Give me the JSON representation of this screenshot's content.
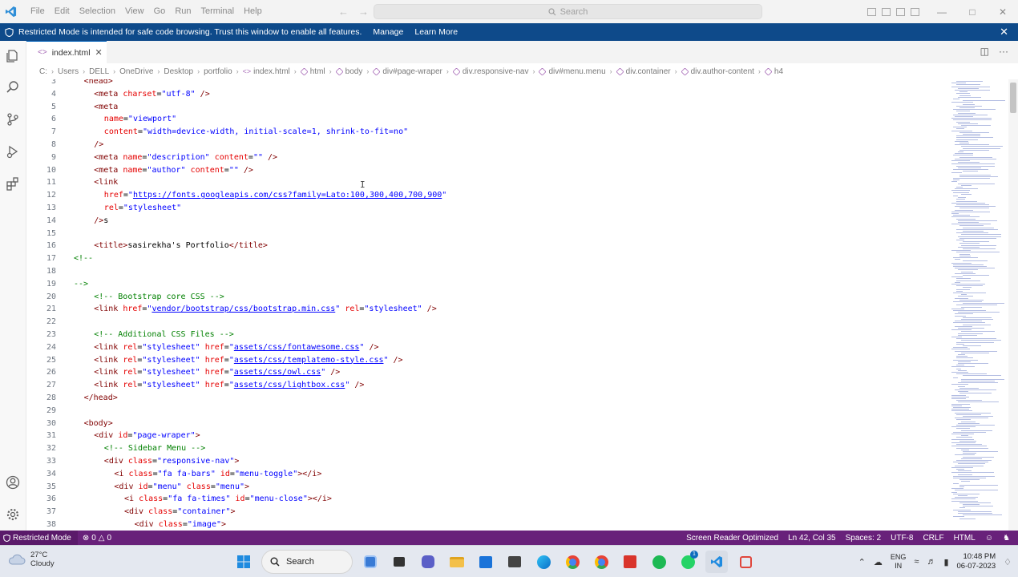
{
  "titlebar": {
    "menu": [
      "File",
      "Edit",
      "Selection",
      "View",
      "Go",
      "Run",
      "Terminal",
      "Help"
    ],
    "search_placeholder": "Search"
  },
  "banner": {
    "message": "Restricted Mode is intended for safe code browsing. Trust this window to enable all features.",
    "manage_label": "Manage",
    "learn_more_label": "Learn More"
  },
  "tab": {
    "label": "index.html"
  },
  "breadcrumb": [
    "C:",
    "Users",
    "DELL",
    "OneDrive",
    "Desktop",
    "portfolio",
    "index.html",
    "html",
    "body",
    "div#page-wraper",
    "div.responsive-nav",
    "div#menu.menu",
    "div.container",
    "div.author-content",
    "h4"
  ],
  "editor": {
    "lines": [
      {
        "n": "3",
        "indent": 1,
        "segs": [
          [
            "tag",
            "<head>"
          ]
        ]
      },
      {
        "n": "4",
        "indent": 2,
        "segs": [
          [
            "tag",
            "<meta "
          ],
          [
            "attr",
            "charset"
          ],
          [
            "txt",
            "="
          ],
          [
            "val",
            "\"utf-8\""
          ],
          [
            "tag",
            " />"
          ]
        ]
      },
      {
        "n": "5",
        "indent": 2,
        "segs": [
          [
            "tag",
            "<meta"
          ]
        ]
      },
      {
        "n": "6",
        "indent": 3,
        "segs": [
          [
            "attr",
            "name"
          ],
          [
            "txt",
            "="
          ],
          [
            "val",
            "\"viewport\""
          ]
        ]
      },
      {
        "n": "7",
        "indent": 3,
        "segs": [
          [
            "attr",
            "content"
          ],
          [
            "txt",
            "="
          ],
          [
            "val",
            "\"width=device-width, initial-scale=1, shrink-to-fit=no\""
          ]
        ]
      },
      {
        "n": "8",
        "indent": 2,
        "segs": [
          [
            "tag",
            "/>"
          ]
        ]
      },
      {
        "n": "9",
        "indent": 2,
        "segs": [
          [
            "tag",
            "<meta "
          ],
          [
            "attr",
            "name"
          ],
          [
            "txt",
            "="
          ],
          [
            "val",
            "\"description\""
          ],
          [
            "txt",
            " "
          ],
          [
            "attr",
            "content"
          ],
          [
            "txt",
            "="
          ],
          [
            "val",
            "\"\""
          ],
          [
            "tag",
            " />"
          ]
        ]
      },
      {
        "n": "10",
        "indent": 2,
        "segs": [
          [
            "tag",
            "<meta "
          ],
          [
            "attr",
            "name"
          ],
          [
            "txt",
            "="
          ],
          [
            "val",
            "\"author\""
          ],
          [
            "txt",
            " "
          ],
          [
            "attr",
            "content"
          ],
          [
            "txt",
            "="
          ],
          [
            "val",
            "\"\""
          ],
          [
            "tag",
            " />"
          ]
        ]
      },
      {
        "n": "11",
        "indent": 2,
        "segs": [
          [
            "tag",
            "<link"
          ]
        ]
      },
      {
        "n": "12",
        "indent": 3,
        "segs": [
          [
            "attr",
            "href"
          ],
          [
            "txt",
            "="
          ],
          [
            "val",
            "\""
          ],
          [
            "lnk",
            "https://fonts.googleapis.com/css?family=Lato:100,300,400,700,900"
          ],
          [
            "val",
            "\""
          ]
        ]
      },
      {
        "n": "13",
        "indent": 3,
        "segs": [
          [
            "attr",
            "rel"
          ],
          [
            "txt",
            "="
          ],
          [
            "val",
            "\"stylesheet\""
          ]
        ]
      },
      {
        "n": "14",
        "indent": 2,
        "segs": [
          [
            "tag",
            "/>"
          ],
          [
            "txt",
            "s"
          ]
        ]
      },
      {
        "n": "15",
        "indent": 0,
        "segs": []
      },
      {
        "n": "16",
        "indent": 2,
        "segs": [
          [
            "tag",
            "<title>"
          ],
          [
            "txt",
            "sasirekha's Portfolio"
          ],
          [
            "tag",
            "</title>"
          ]
        ]
      },
      {
        "n": "17",
        "indent": 0,
        "segs": [
          [
            "cmt",
            "<!--"
          ]
        ]
      },
      {
        "n": "18",
        "indent": 0,
        "segs": []
      },
      {
        "n": "19",
        "indent": 0,
        "segs": [
          [
            "cmt",
            "-->"
          ]
        ]
      },
      {
        "n": "20",
        "indent": 2,
        "segs": [
          [
            "cmt",
            "<!-- Bootstrap core CSS -->"
          ]
        ]
      },
      {
        "n": "21",
        "indent": 2,
        "segs": [
          [
            "tag",
            "<link "
          ],
          [
            "attr",
            "href"
          ],
          [
            "txt",
            "="
          ],
          [
            "val",
            "\""
          ],
          [
            "lnk",
            "vendor/bootstrap/css/bootstrap.min.css"
          ],
          [
            "val",
            "\""
          ],
          [
            "txt",
            " "
          ],
          [
            "attr",
            "rel"
          ],
          [
            "txt",
            "="
          ],
          [
            "val",
            "\"stylesheet\""
          ],
          [
            "tag",
            " />"
          ]
        ]
      },
      {
        "n": "22",
        "indent": 0,
        "segs": []
      },
      {
        "n": "23",
        "indent": 2,
        "segs": [
          [
            "cmt",
            "<!-- Additional CSS Files -->"
          ]
        ]
      },
      {
        "n": "24",
        "indent": 2,
        "segs": [
          [
            "tag",
            "<link "
          ],
          [
            "attr",
            "rel"
          ],
          [
            "txt",
            "="
          ],
          [
            "val",
            "\"stylesheet\""
          ],
          [
            "txt",
            " "
          ],
          [
            "attr",
            "href"
          ],
          [
            "txt",
            "="
          ],
          [
            "val",
            "\""
          ],
          [
            "lnk",
            "assets/css/fontawesome.css"
          ],
          [
            "val",
            "\""
          ],
          [
            "tag",
            " />"
          ]
        ]
      },
      {
        "n": "25",
        "indent": 2,
        "segs": [
          [
            "tag",
            "<link "
          ],
          [
            "attr",
            "rel"
          ],
          [
            "txt",
            "="
          ],
          [
            "val",
            "\"stylesheet\""
          ],
          [
            "txt",
            " "
          ],
          [
            "attr",
            "href"
          ],
          [
            "txt",
            "="
          ],
          [
            "val",
            "\""
          ],
          [
            "lnk",
            "assets/css/templatemo-style.css"
          ],
          [
            "val",
            "\""
          ],
          [
            "tag",
            " />"
          ]
        ]
      },
      {
        "n": "26",
        "indent": 2,
        "segs": [
          [
            "tag",
            "<link "
          ],
          [
            "attr",
            "rel"
          ],
          [
            "txt",
            "="
          ],
          [
            "val",
            "\"stylesheet\""
          ],
          [
            "txt",
            " "
          ],
          [
            "attr",
            "href"
          ],
          [
            "txt",
            "="
          ],
          [
            "val",
            "\""
          ],
          [
            "lnk",
            "assets/css/owl.css"
          ],
          [
            "val",
            "\""
          ],
          [
            "tag",
            " />"
          ]
        ]
      },
      {
        "n": "27",
        "indent": 2,
        "segs": [
          [
            "tag",
            "<link "
          ],
          [
            "attr",
            "rel"
          ],
          [
            "txt",
            "="
          ],
          [
            "val",
            "\"stylesheet\""
          ],
          [
            "txt",
            " "
          ],
          [
            "attr",
            "href"
          ],
          [
            "txt",
            "="
          ],
          [
            "val",
            "\""
          ],
          [
            "lnk",
            "assets/css/lightbox.css"
          ],
          [
            "val",
            "\""
          ],
          [
            "tag",
            " />"
          ]
        ]
      },
      {
        "n": "28",
        "indent": 1,
        "segs": [
          [
            "tag",
            "</head>"
          ]
        ]
      },
      {
        "n": "29",
        "indent": 0,
        "segs": []
      },
      {
        "n": "30",
        "indent": 1,
        "segs": [
          [
            "tag",
            "<body>"
          ]
        ]
      },
      {
        "n": "31",
        "indent": 2,
        "segs": [
          [
            "tag",
            "<div "
          ],
          [
            "attr",
            "id"
          ],
          [
            "txt",
            "="
          ],
          [
            "val",
            "\"page-wraper\""
          ],
          [
            "tag",
            ">"
          ]
        ]
      },
      {
        "n": "32",
        "indent": 3,
        "segs": [
          [
            "cmt",
            "<!-- Sidebar Menu -->"
          ]
        ]
      },
      {
        "n": "33",
        "indent": 3,
        "segs": [
          [
            "tag",
            "<div "
          ],
          [
            "attr",
            "class"
          ],
          [
            "txt",
            "="
          ],
          [
            "val",
            "\"responsive-nav\""
          ],
          [
            "tag",
            ">"
          ]
        ]
      },
      {
        "n": "34",
        "indent": 4,
        "segs": [
          [
            "tag",
            "<i "
          ],
          [
            "attr",
            "class"
          ],
          [
            "txt",
            "="
          ],
          [
            "val",
            "\"fa fa-bars\""
          ],
          [
            "txt",
            " "
          ],
          [
            "attr",
            "id"
          ],
          [
            "txt",
            "="
          ],
          [
            "val",
            "\"menu-toggle\""
          ],
          [
            "tag",
            "></i>"
          ]
        ]
      },
      {
        "n": "35",
        "indent": 4,
        "segs": [
          [
            "tag",
            "<div "
          ],
          [
            "attr",
            "id"
          ],
          [
            "txt",
            "="
          ],
          [
            "val",
            "\"menu\""
          ],
          [
            "txt",
            " "
          ],
          [
            "attr",
            "class"
          ],
          [
            "txt",
            "="
          ],
          [
            "val",
            "\"menu\""
          ],
          [
            "tag",
            ">"
          ]
        ]
      },
      {
        "n": "36",
        "indent": 5,
        "segs": [
          [
            "tag",
            "<i "
          ],
          [
            "attr",
            "class"
          ],
          [
            "txt",
            "="
          ],
          [
            "val",
            "\"fa fa-times\""
          ],
          [
            "txt",
            " "
          ],
          [
            "attr",
            "id"
          ],
          [
            "txt",
            "="
          ],
          [
            "val",
            "\"menu-close\""
          ],
          [
            "tag",
            "></i>"
          ]
        ]
      },
      {
        "n": "37",
        "indent": 5,
        "segs": [
          [
            "tag",
            "<div "
          ],
          [
            "attr",
            "class"
          ],
          [
            "txt",
            "="
          ],
          [
            "val",
            "\"container\""
          ],
          [
            "tag",
            ">"
          ]
        ]
      },
      {
        "n": "38",
        "indent": 6,
        "segs": [
          [
            "tag",
            "<div "
          ],
          [
            "attr",
            "class"
          ],
          [
            "txt",
            "="
          ],
          [
            "val",
            "\"image\""
          ],
          [
            "tag",
            ">"
          ]
        ]
      }
    ],
    "cursor_glyph": "I"
  },
  "statusbar": {
    "restricted": "Restricted Mode",
    "errors": "0",
    "warnings": "0",
    "screen_reader": "Screen Reader Optimized",
    "position": "Ln 42, Col 35",
    "spaces": "Spaces: 2",
    "encoding": "UTF-8",
    "eol": "CRLF",
    "language": "HTML"
  },
  "taskbar": {
    "temperature": "27°C",
    "condition": "Cloudy",
    "search_label": "Search",
    "lang_line1": "ENG",
    "lang_line2": "IN",
    "time": "10:48 PM",
    "date": "06-07-2023",
    "whatsapp_badge": "1"
  },
  "colors": {
    "banner": "#0e4a8a",
    "statusbar": "#68217a",
    "tag": "#800000",
    "attribute": "#e50000",
    "value": "#0000ff",
    "comment": "#008000"
  }
}
